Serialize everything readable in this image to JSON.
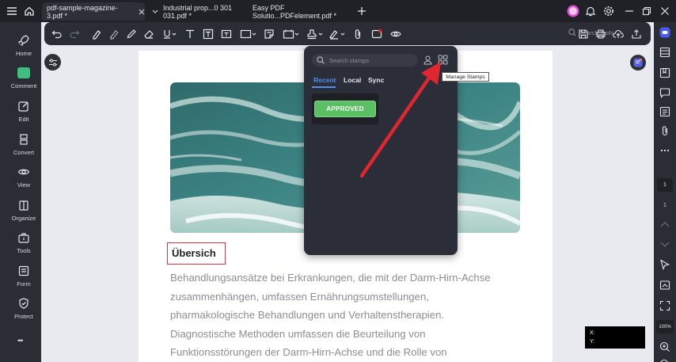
{
  "tabs": [
    {
      "label": "pdf-sample-magazine-3.pdf *",
      "active": true
    },
    {
      "label": "Industrial  prop...0 301 031.pdf *",
      "active": false
    },
    {
      "label": "Easy PDF Solutio...PDFelement.pdf *",
      "active": false
    }
  ],
  "sidebar": {
    "items": [
      {
        "label": "Home",
        "icon": "rocket-icon"
      },
      {
        "label": "Comment",
        "icon": "comment-icon"
      },
      {
        "label": "Edit",
        "icon": "edit-icon"
      },
      {
        "label": "Convert",
        "icon": "convert-icon"
      },
      {
        "label": "View",
        "icon": "eye-icon"
      },
      {
        "label": "Organize",
        "icon": "organize-icon"
      },
      {
        "label": "Tools",
        "icon": "toolbox-icon"
      },
      {
        "label": "Form",
        "icon": "form-icon"
      },
      {
        "label": "Protect",
        "icon": "shield-icon"
      }
    ],
    "more": "•••"
  },
  "toolbar": {
    "search_placeholder": "Search Tools"
  },
  "stamp_panel": {
    "search_placeholder": "Search stamps",
    "tabs": [
      "Recent",
      "Local",
      "Sync"
    ],
    "active_tab": "Recent",
    "stamps": [
      "APPROVED"
    ],
    "tooltip": "Manage Stamps"
  },
  "document": {
    "heading": "Übersich",
    "lines": [
      "Behandlungsansätze bei Erkrankungen, die mit der Darm-Hirn-Achse",
      "zusammenhängen, umfassen Ernährungsumstellungen,",
      "pharmakologische Behandlungen und Verhaltenstherapien.",
      "Diagnostische Methoden umfassen die Beurteilung von",
      "Funktionsstörungen der Darm-Hirn-Achse und die Rolle von"
    ]
  },
  "right_panel": {
    "current_page": "1",
    "total_pages": "1",
    "zoom": "100%"
  },
  "coords": {
    "x_label": "X:",
    "y_label": "Y:"
  },
  "colors": {
    "accent": "#4f8ff0",
    "stamp_green": "#5bbf63",
    "highlight_red": "#d9343f",
    "arrow_red": "#e0262e"
  }
}
